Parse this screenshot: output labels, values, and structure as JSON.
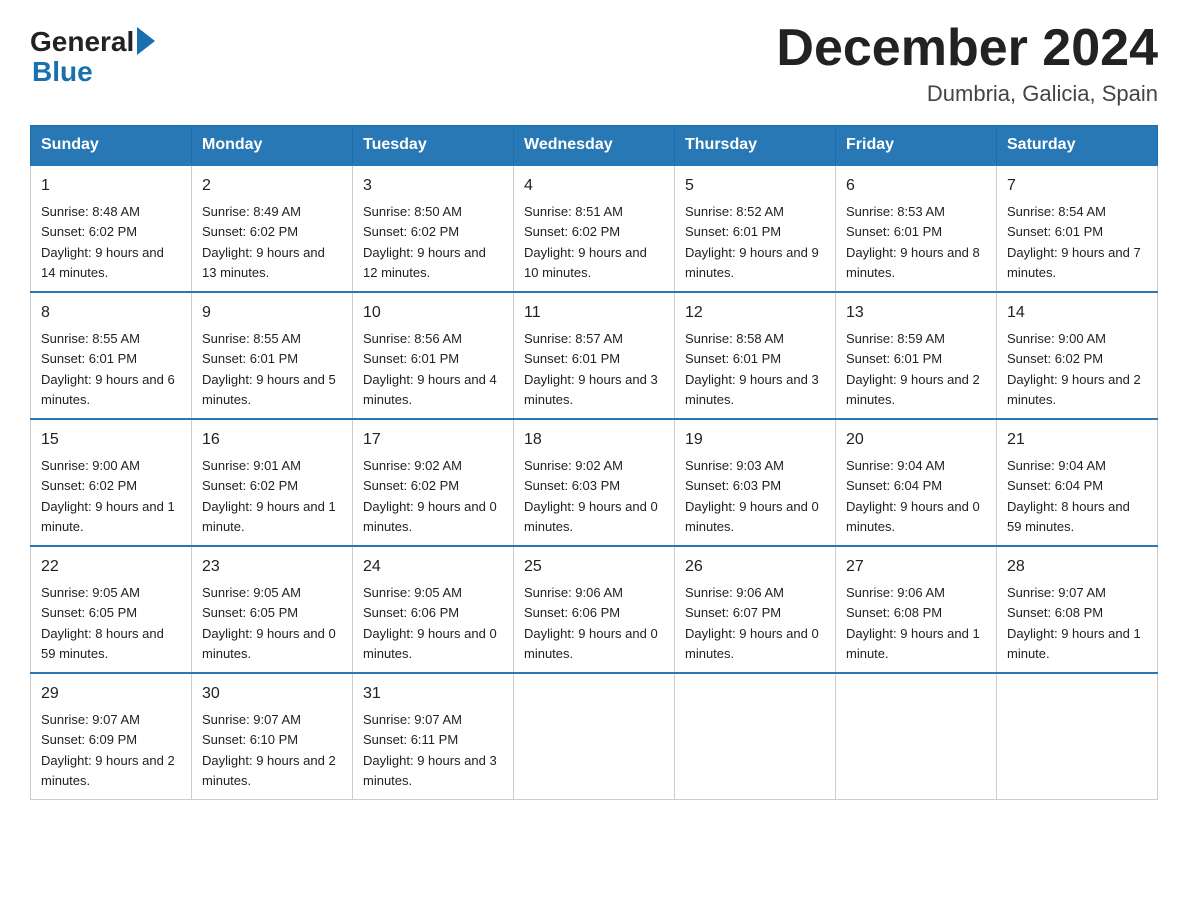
{
  "logo": {
    "general": "General",
    "blue": "Blue"
  },
  "title": "December 2024",
  "location": "Dumbria, Galicia, Spain",
  "days_of_week": [
    "Sunday",
    "Monday",
    "Tuesday",
    "Wednesday",
    "Thursday",
    "Friday",
    "Saturday"
  ],
  "weeks": [
    [
      {
        "day": "1",
        "sunrise": "8:48 AM",
        "sunset": "6:02 PM",
        "daylight": "9 hours and 14 minutes."
      },
      {
        "day": "2",
        "sunrise": "8:49 AM",
        "sunset": "6:02 PM",
        "daylight": "9 hours and 13 minutes."
      },
      {
        "day": "3",
        "sunrise": "8:50 AM",
        "sunset": "6:02 PM",
        "daylight": "9 hours and 12 minutes."
      },
      {
        "day": "4",
        "sunrise": "8:51 AM",
        "sunset": "6:02 PM",
        "daylight": "9 hours and 10 minutes."
      },
      {
        "day": "5",
        "sunrise": "8:52 AM",
        "sunset": "6:01 PM",
        "daylight": "9 hours and 9 minutes."
      },
      {
        "day": "6",
        "sunrise": "8:53 AM",
        "sunset": "6:01 PM",
        "daylight": "9 hours and 8 minutes."
      },
      {
        "day": "7",
        "sunrise": "8:54 AM",
        "sunset": "6:01 PM",
        "daylight": "9 hours and 7 minutes."
      }
    ],
    [
      {
        "day": "8",
        "sunrise": "8:55 AM",
        "sunset": "6:01 PM",
        "daylight": "9 hours and 6 minutes."
      },
      {
        "day": "9",
        "sunrise": "8:55 AM",
        "sunset": "6:01 PM",
        "daylight": "9 hours and 5 minutes."
      },
      {
        "day": "10",
        "sunrise": "8:56 AM",
        "sunset": "6:01 PM",
        "daylight": "9 hours and 4 minutes."
      },
      {
        "day": "11",
        "sunrise": "8:57 AM",
        "sunset": "6:01 PM",
        "daylight": "9 hours and 3 minutes."
      },
      {
        "day": "12",
        "sunrise": "8:58 AM",
        "sunset": "6:01 PM",
        "daylight": "9 hours and 3 minutes."
      },
      {
        "day": "13",
        "sunrise": "8:59 AM",
        "sunset": "6:01 PM",
        "daylight": "9 hours and 2 minutes."
      },
      {
        "day": "14",
        "sunrise": "9:00 AM",
        "sunset": "6:02 PM",
        "daylight": "9 hours and 2 minutes."
      }
    ],
    [
      {
        "day": "15",
        "sunrise": "9:00 AM",
        "sunset": "6:02 PM",
        "daylight": "9 hours and 1 minute."
      },
      {
        "day": "16",
        "sunrise": "9:01 AM",
        "sunset": "6:02 PM",
        "daylight": "9 hours and 1 minute."
      },
      {
        "day": "17",
        "sunrise": "9:02 AM",
        "sunset": "6:02 PM",
        "daylight": "9 hours and 0 minutes."
      },
      {
        "day": "18",
        "sunrise": "9:02 AM",
        "sunset": "6:03 PM",
        "daylight": "9 hours and 0 minutes."
      },
      {
        "day": "19",
        "sunrise": "9:03 AM",
        "sunset": "6:03 PM",
        "daylight": "9 hours and 0 minutes."
      },
      {
        "day": "20",
        "sunrise": "9:04 AM",
        "sunset": "6:04 PM",
        "daylight": "9 hours and 0 minutes."
      },
      {
        "day": "21",
        "sunrise": "9:04 AM",
        "sunset": "6:04 PM",
        "daylight": "8 hours and 59 minutes."
      }
    ],
    [
      {
        "day": "22",
        "sunrise": "9:05 AM",
        "sunset": "6:05 PM",
        "daylight": "8 hours and 59 minutes."
      },
      {
        "day": "23",
        "sunrise": "9:05 AM",
        "sunset": "6:05 PM",
        "daylight": "9 hours and 0 minutes."
      },
      {
        "day": "24",
        "sunrise": "9:05 AM",
        "sunset": "6:06 PM",
        "daylight": "9 hours and 0 minutes."
      },
      {
        "day": "25",
        "sunrise": "9:06 AM",
        "sunset": "6:06 PM",
        "daylight": "9 hours and 0 minutes."
      },
      {
        "day": "26",
        "sunrise": "9:06 AM",
        "sunset": "6:07 PM",
        "daylight": "9 hours and 0 minutes."
      },
      {
        "day": "27",
        "sunrise": "9:06 AM",
        "sunset": "6:08 PM",
        "daylight": "9 hours and 1 minute."
      },
      {
        "day": "28",
        "sunrise": "9:07 AM",
        "sunset": "6:08 PM",
        "daylight": "9 hours and 1 minute."
      }
    ],
    [
      {
        "day": "29",
        "sunrise": "9:07 AM",
        "sunset": "6:09 PM",
        "daylight": "9 hours and 2 minutes."
      },
      {
        "day": "30",
        "sunrise": "9:07 AM",
        "sunset": "6:10 PM",
        "daylight": "9 hours and 2 minutes."
      },
      {
        "day": "31",
        "sunrise": "9:07 AM",
        "sunset": "6:11 PM",
        "daylight": "9 hours and 3 minutes."
      },
      null,
      null,
      null,
      null
    ]
  ]
}
